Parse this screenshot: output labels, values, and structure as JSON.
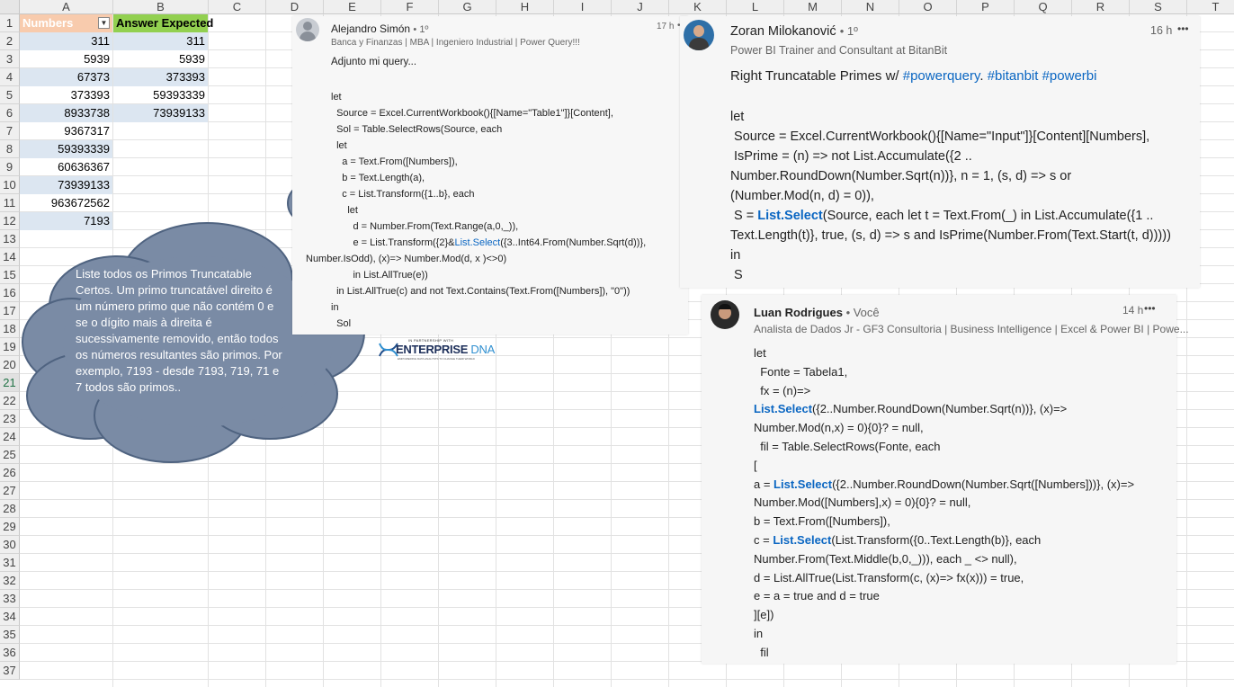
{
  "sheet": {
    "columns": [
      "A",
      "B",
      "C",
      "D",
      "E",
      "F",
      "G",
      "H",
      "I",
      "J",
      "K",
      "L",
      "M",
      "N",
      "O",
      "P",
      "Q",
      "R",
      "S",
      "T"
    ],
    "rows": [
      "1",
      "2",
      "3",
      "4",
      "5",
      "6",
      "7",
      "8",
      "9",
      "10",
      "11",
      "12",
      "13",
      "14",
      "15",
      "16",
      "17",
      "18",
      "19",
      "20",
      "21",
      "22",
      "23",
      "24",
      "25",
      "26",
      "27",
      "28",
      "29",
      "30",
      "31",
      "32",
      "33",
      "34",
      "35",
      "36",
      "37"
    ],
    "selected_row": "21",
    "header_a": "Numbers",
    "header_b": "Answer Expected",
    "numbers": [
      "311",
      "5939",
      "67373",
      "373393",
      "8933738",
      "9367317",
      "59393339",
      "60636367",
      "73939133",
      "963672562",
      "7193"
    ],
    "answers": [
      "311",
      "5939",
      "373393",
      "59393339",
      "73939133"
    ]
  },
  "cloud": {
    "text": "Liste todos os Primos Truncatable Certos. Um primo truncatável direito é um número primo que não contém 0 e se o dígito mais à direita é sucessivamente removido, então todos os números resultantes são primos. Por exemplo, 7193 - desde 7193, 719, 71 e 7 todos são primos.."
  },
  "logo": {
    "top": "IN PARTNERSHIP WITH",
    "main": "ENTERPRISE",
    "accent": "DNA",
    "tagline": "EMPOWERING DATA ANALYSTS TO CHANGE THEIR WORLD"
  },
  "post1": {
    "name": "Alejandro Simón",
    "degree": "• 1º",
    "time": "17 h",
    "more": "•",
    "headline": "Banca y Finanzas | MBA | Ingeniero Industrial | Power Query!!!",
    "intro": "Adjunto mi query...",
    "code": {
      "l1": "let",
      "l2": "  Source = Excel.CurrentWorkbook(){[Name=\"Table1\"]}[Content],",
      "l3": "  Sol = Table.SelectRows(Source, each",
      "l4": "  let",
      "l5": "    a = Text.From([Numbers]),",
      "l6": "    b = Text.Length(a),",
      "l7": "    c = List.Transform({1..b}, each",
      "l8": "      let",
      "l9": "        d = Number.From(Text.Range(a,0,_)),",
      "l10a": "        e = List.Transform({2}&",
      "l10b": "List.Select",
      "l10c": "({3..Int64.From(Number.Sqrt(d))},",
      "l11": "Number.IsOdd), (x)=> Number.Mod(d, x )<>0)",
      "l12": "        in List.AllTrue(e))",
      "l13": "  in List.AllTrue(c) and not Text.Contains(Text.From([Numbers]), \"0\"))",
      "l14": "in",
      "l15": "  Sol"
    }
  },
  "post2": {
    "name": "Zoran Milokanović",
    "degree": "• 1º",
    "time": "16 h",
    "more": "•••",
    "headline": "Power BI Trainer and Consultant at BitanBit",
    "title_text": "Right Truncatable Primes w/ ",
    "tag1": "#powerquery",
    "dot": ". ",
    "tag2": "#bitanbit",
    "tag3": "#powerbi",
    "code": {
      "l1": "let",
      "l2": " Source = Excel.CurrentWorkbook(){[Name=\"Input\"]}[Content][Numbers],",
      "l3": " IsPrime = (n) => not List.Accumulate({2 ..",
      "l4": "Number.RoundDown(Number.Sqrt(n))}, n = 1, (s, d) => s or",
      "l5": "(Number.Mod(n, d) = 0)),",
      "l6a": " S = ",
      "l6b": "List.Select",
      "l6c": "(Source, each let t = Text.From(_) in List.Accumulate({1 ..",
      "l7": "Text.Length(t)}, true, (s, d) => s and IsPrime(Number.From(Text.Start(t, d)))))",
      "l8": "in",
      "l9": " S"
    }
  },
  "post3": {
    "name": "Luan Rodrigues",
    "you": " • Você",
    "time": "14 h",
    "more": "•••",
    "headline": "Analista de Dados Jr - GF3 Consultoria | Business Intelligence | Excel & Power BI | Powe...",
    "code": {
      "l1": "let",
      "l2": "  Fonte = Tabela1,",
      "l3": "  fx = (n)=>",
      "l4a": "List.Select",
      "l4b": "({2..Number.RoundDown(Number.Sqrt(n))}, (x)=>",
      "l5": "Number.Mod(n,x) = 0){0}? = null,",
      "l6": "  fil = Table.SelectRows(Fonte, each",
      "l7": "[",
      "l8a": "a = ",
      "l8b": "List.Select",
      "l8c": "({2..Number.RoundDown(Number.Sqrt([Numbers]))}, (x)=>",
      "l9": "Number.Mod([Numbers],x) = 0){0}? = null,",
      "l10": "b = Text.From([Numbers]),",
      "l11a": "c = ",
      "l11b": "List.Select",
      "l11c": "(List.Transform({0..Text.Length(b)}, each",
      "l12": "Number.From(Text.Middle(b,0,_))), each _ <> null),",
      "l13": "d = List.AllTrue(List.Transform(c, (x)=> fx(x))) = true,",
      "l14": "e = a = true and d = true",
      "l15": "][e])",
      "l16": "in",
      "l17": "  fil"
    }
  },
  "colors": {
    "link": "#0a66c2",
    "cloud": "#7a8ba5",
    "band": "#dce6f1",
    "header_a": "#f8cbad",
    "header_b": "#92d050"
  }
}
